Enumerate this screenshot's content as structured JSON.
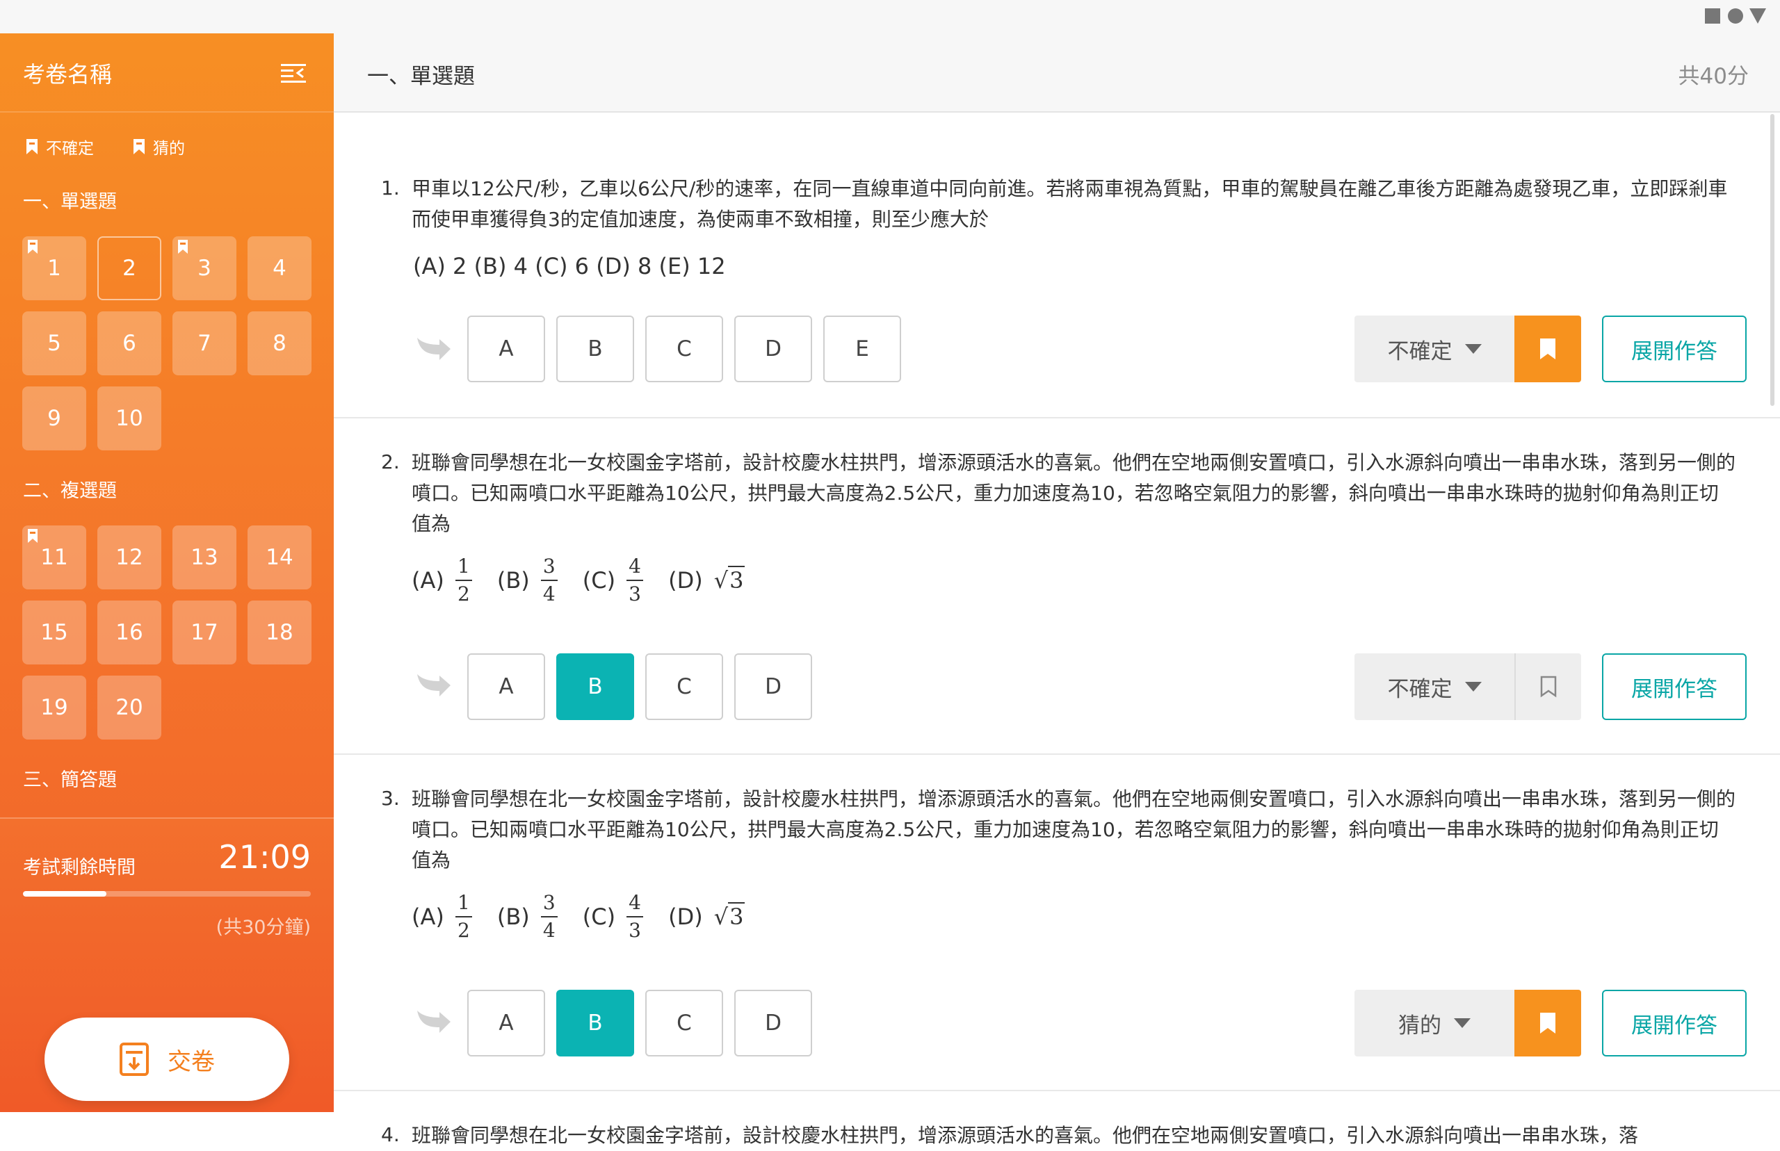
{
  "sidebar": {
    "exam_title": "考卷名稱",
    "legend": {
      "unsure": "不確定",
      "guess": "猜的"
    },
    "sections": [
      {
        "title": "一、單選題",
        "questions": [
          "1",
          "2",
          "3",
          "4",
          "5",
          "6",
          "7",
          "8",
          "9",
          "10"
        ]
      },
      {
        "title": "二、複選題",
        "questions": [
          "11",
          "12",
          "13",
          "14",
          "15",
          "16",
          "17",
          "18",
          "19",
          "20"
        ]
      },
      {
        "title": "三、簡答題",
        "questions": []
      }
    ],
    "marked_questions": [
      "1",
      "3",
      "11"
    ],
    "current_question": "2",
    "timer": {
      "label": "考試剩餘時間",
      "remaining": "21:09",
      "total": "(共30分鐘)",
      "progress": 0.29
    },
    "submit_label": "交卷"
  },
  "main": {
    "section_heading": "一、單選題",
    "total_score": "共40分",
    "expand_label": "展開作答",
    "questions": [
      {
        "number": "1.",
        "text": "甲車以12公尺/秒，乙車以6公尺/秒的速率，在同一直線車道中同向前進。若將兩車視為質點，甲車的駕駛員在離乙車後方距離為處發現乙車，立即踩剎車而使甲車獲得負3的定值加速度，為使兩車不致相撞，則至少應大於",
        "options_text": "(A) 2   (B) 4   (C) 6   (D) 8   (E) 12",
        "answers": [
          "A",
          "B",
          "C",
          "D",
          "E"
        ],
        "selected": "",
        "status": "不確定",
        "bookmarked": true
      },
      {
        "number": "2.",
        "text": "班聯會同學想在北一女校園金字塔前，設計校慶水柱拱門，增添源頭活水的喜氣。他們在空地兩側安置噴口，引入水源斜向噴出一串串水珠，落到另一側的噴口。已知兩噴口水平距離為10公尺，拱門最大高度為2.5公尺，重力加速度為10，若忽略空氣阻力的影響，斜向噴出一串串水珠時的拋射仰角為則正切值為",
        "options_math": {
          "A": {
            "label": "(A)",
            "num": "1",
            "den": "2"
          },
          "B": {
            "label": "(B)",
            "num": "3",
            "den": "4"
          },
          "C": {
            "label": "(C)",
            "num": "4",
            "den": "3"
          },
          "D": {
            "label": "(D)",
            "root": "3"
          }
        },
        "answers": [
          "A",
          "B",
          "C",
          "D"
        ],
        "selected": "B",
        "status": "不確定",
        "bookmarked": false
      },
      {
        "number": "3.",
        "text": "班聯會同學想在北一女校園金字塔前，設計校慶水柱拱門，增添源頭活水的喜氣。他們在空地兩側安置噴口，引入水源斜向噴出一串串水珠，落到另一側的噴口。已知兩噴口水平距離為10公尺，拱門最大高度為2.5公尺，重力加速度為10，若忽略空氣阻力的影響，斜向噴出一串串水珠時的拋射仰角為則正切值為",
        "options_math": {
          "A": {
            "label": "(A)",
            "num": "1",
            "den": "2"
          },
          "B": {
            "label": "(B)",
            "num": "3",
            "den": "4"
          },
          "C": {
            "label": "(C)",
            "num": "4",
            "den": "3"
          },
          "D": {
            "label": "(D)",
            "root": "3"
          }
        },
        "answers": [
          "A",
          "B",
          "C",
          "D"
        ],
        "selected": "B",
        "status": "猜的",
        "bookmarked": true
      },
      {
        "number": "4.",
        "text": "班聯會同學想在北一女校園金字塔前，設計校慶水柱拱門，增添源頭活水的喜氣。他們在空地兩側安置噴口，引入水源斜向噴出一串串水珠，落"
      }
    ]
  },
  "colors": {
    "accent_orange": "#f7921e",
    "selected_teal": "#0bb3b3",
    "expand_teal": "#0aa6a6"
  },
  "icons": {
    "menu": "collapse-menu-icon",
    "bookmark": "bookmark-icon",
    "next": "next-arrow-icon",
    "submit": "submit-document-icon"
  }
}
